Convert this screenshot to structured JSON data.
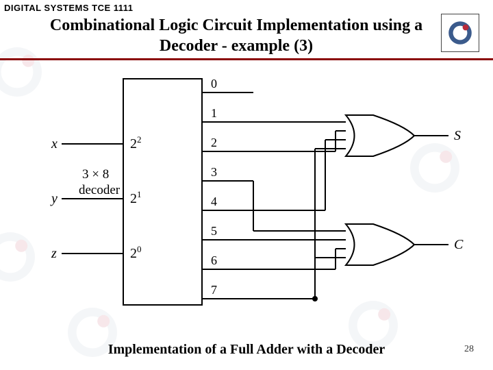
{
  "header": {
    "course": "DIGITAL SYSTEMS TCE 1111"
  },
  "title": {
    "line1": "Combinational Logic Circuit Implementation using a",
    "line2": "Decoder -  example (3)"
  },
  "diagram": {
    "inputs": [
      {
        "name": "x",
        "pin": "2",
        "exp": "2"
      },
      {
        "name": "y",
        "pin": "2",
        "exp": "1"
      },
      {
        "name": "z",
        "pin": "2",
        "exp": "0"
      }
    ],
    "block_label_a": "3 × 8",
    "block_label_b": "decoder",
    "outputs": [
      "0",
      "1",
      "2",
      "3",
      "4",
      "5",
      "6",
      "7"
    ],
    "gate_outputs": [
      "S",
      "C"
    ]
  },
  "caption": "Implementation of a Full Adder with a Decoder",
  "page": "28"
}
